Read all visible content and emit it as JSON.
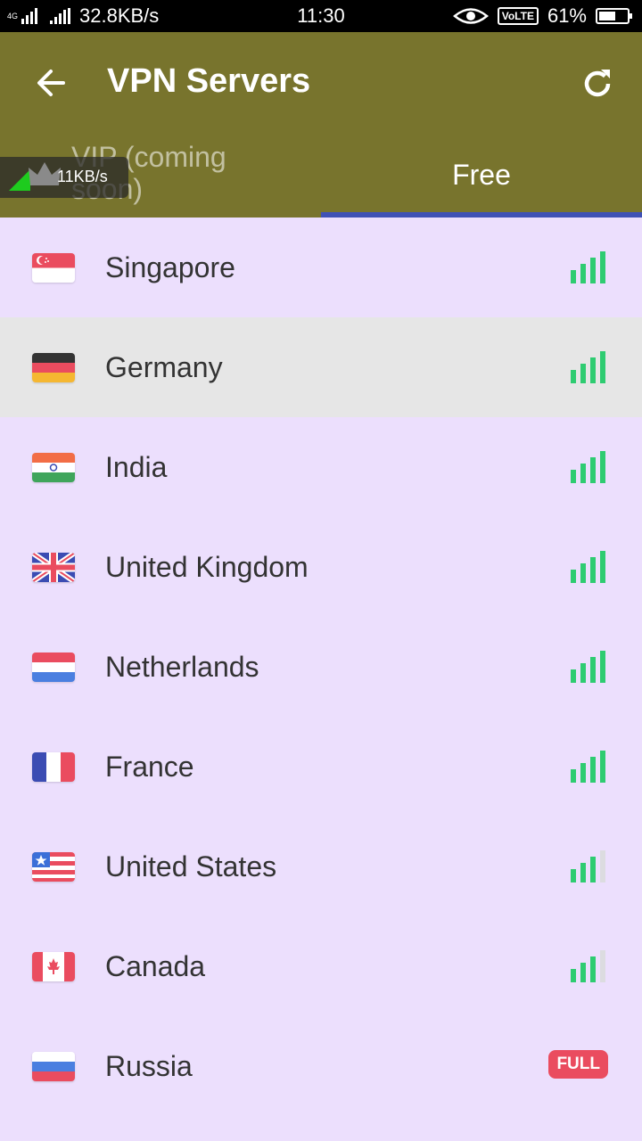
{
  "status_bar": {
    "network_label": "4G",
    "net_speed": "32.8KB/s",
    "time": "11:30",
    "volte": "VoLTE",
    "battery": "61%",
    "battery_level": 0.61
  },
  "app_bar": {
    "title": "VPN Servers",
    "back_icon": "arrow-back-icon",
    "refresh_icon": "refresh-icon"
  },
  "tabs": [
    {
      "label": "VIP (coming soon)",
      "selected": false
    },
    {
      "label": "Free",
      "selected": true
    }
  ],
  "speed_widget": {
    "speed": "11KB/s"
  },
  "colors": {
    "app_bar": "#78742d",
    "list_bg": "#ecdffd",
    "selected_row": "#e6e6e6",
    "tab_indicator": "#3f51b5",
    "signal": "#2ecc71",
    "full_badge": "#ea4c5f"
  },
  "servers": [
    {
      "name": "Singapore",
      "flag": "singapore-flag",
      "signal_bars": 4,
      "selected": false
    },
    {
      "name": "Germany",
      "flag": "germany-flag",
      "signal_bars": 4,
      "selected": true
    },
    {
      "name": "India",
      "flag": "india-flag",
      "signal_bars": 4,
      "selected": false
    },
    {
      "name": "United Kingdom",
      "flag": "uk-flag",
      "signal_bars": 4,
      "selected": false
    },
    {
      "name": "Netherlands",
      "flag": "netherlands-flag",
      "signal_bars": 4,
      "selected": false
    },
    {
      "name": "France",
      "flag": "france-flag",
      "signal_bars": 4,
      "selected": false
    },
    {
      "name": "United States",
      "flag": "usa-flag",
      "signal_bars": 3,
      "selected": false
    },
    {
      "name": "Canada",
      "flag": "canada-flag",
      "signal_bars": 3,
      "selected": false
    },
    {
      "name": "Russia",
      "flag": "russia-flag",
      "badge": "FULL",
      "selected": false
    }
  ]
}
